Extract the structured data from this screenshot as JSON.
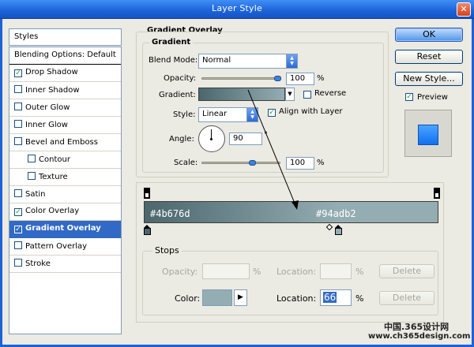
{
  "window": {
    "title": "Layer Style"
  },
  "left_panel": {
    "header": "Styles",
    "items": [
      {
        "label": "Blending Options: Default",
        "checkbox": false,
        "checked": false,
        "indent": false,
        "selected": false
      },
      {
        "label": "Drop Shadow",
        "checkbox": true,
        "checked": true,
        "indent": false,
        "selected": false
      },
      {
        "label": "Inner Shadow",
        "checkbox": true,
        "checked": false,
        "indent": false,
        "selected": false
      },
      {
        "label": "Outer Glow",
        "checkbox": true,
        "checked": false,
        "indent": false,
        "selected": false
      },
      {
        "label": "Inner Glow",
        "checkbox": true,
        "checked": false,
        "indent": false,
        "selected": false
      },
      {
        "label": "Bevel and Emboss",
        "checkbox": true,
        "checked": false,
        "indent": false,
        "selected": false
      },
      {
        "label": "Contour",
        "checkbox": true,
        "checked": false,
        "indent": true,
        "selected": false
      },
      {
        "label": "Texture",
        "checkbox": true,
        "checked": false,
        "indent": true,
        "selected": false
      },
      {
        "label": "Satin",
        "checkbox": true,
        "checked": false,
        "indent": false,
        "selected": false
      },
      {
        "label": "Color Overlay",
        "checkbox": true,
        "checked": true,
        "indent": false,
        "selected": false
      },
      {
        "label": "Gradient Overlay",
        "checkbox": true,
        "checked": true,
        "indent": false,
        "selected": true
      },
      {
        "label": "Pattern Overlay",
        "checkbox": true,
        "checked": false,
        "indent": false,
        "selected": false
      },
      {
        "label": "Stroke",
        "checkbox": true,
        "checked": false,
        "indent": false,
        "selected": false
      }
    ]
  },
  "gradient_overlay": {
    "section_title": "Gradient Overlay",
    "group_title": "Gradient",
    "blend_mode_label": "Blend Mode:",
    "blend_mode_value": "Normal",
    "opacity_label": "Opacity:",
    "opacity_value": "100",
    "opacity_unit": "%",
    "opacity_level": 1.0,
    "gradient_label": "Gradient:",
    "reverse_label": "Reverse",
    "reverse_checked": false,
    "style_label": "Style:",
    "style_value": "Linear",
    "align_label": "Align with Layer",
    "align_checked": true,
    "angle_label": "Angle:",
    "angle_value": "90",
    "angle_unit": "°",
    "scale_label": "Scale:",
    "scale_value": "100",
    "scale_unit": "%",
    "scale_level": 0.5
  },
  "buttons": {
    "ok": "OK",
    "reset": "Reset",
    "new_style": "New Style...",
    "preview_label": "Preview",
    "preview_checked": true
  },
  "gradient_editor": {
    "color_start": "#4b676d",
    "color_end": "#94adb2",
    "label_start": "#4b676d",
    "label_end": "#94adb2"
  },
  "stops": {
    "title": "Stops",
    "opacity_label": "Opacity:",
    "opacity_unit": "%",
    "location_label_top": "Location:",
    "location_unit_top": "%",
    "delete_top": "Delete",
    "color_label": "Color:",
    "color_swatch": "#94adb2",
    "location_label": "Location:",
    "location_value": "66",
    "location_unit": "%",
    "delete_bottom": "Delete"
  },
  "watermark": {
    "line1": "中国.365设计网",
    "line2": "www.ch365design.com"
  }
}
